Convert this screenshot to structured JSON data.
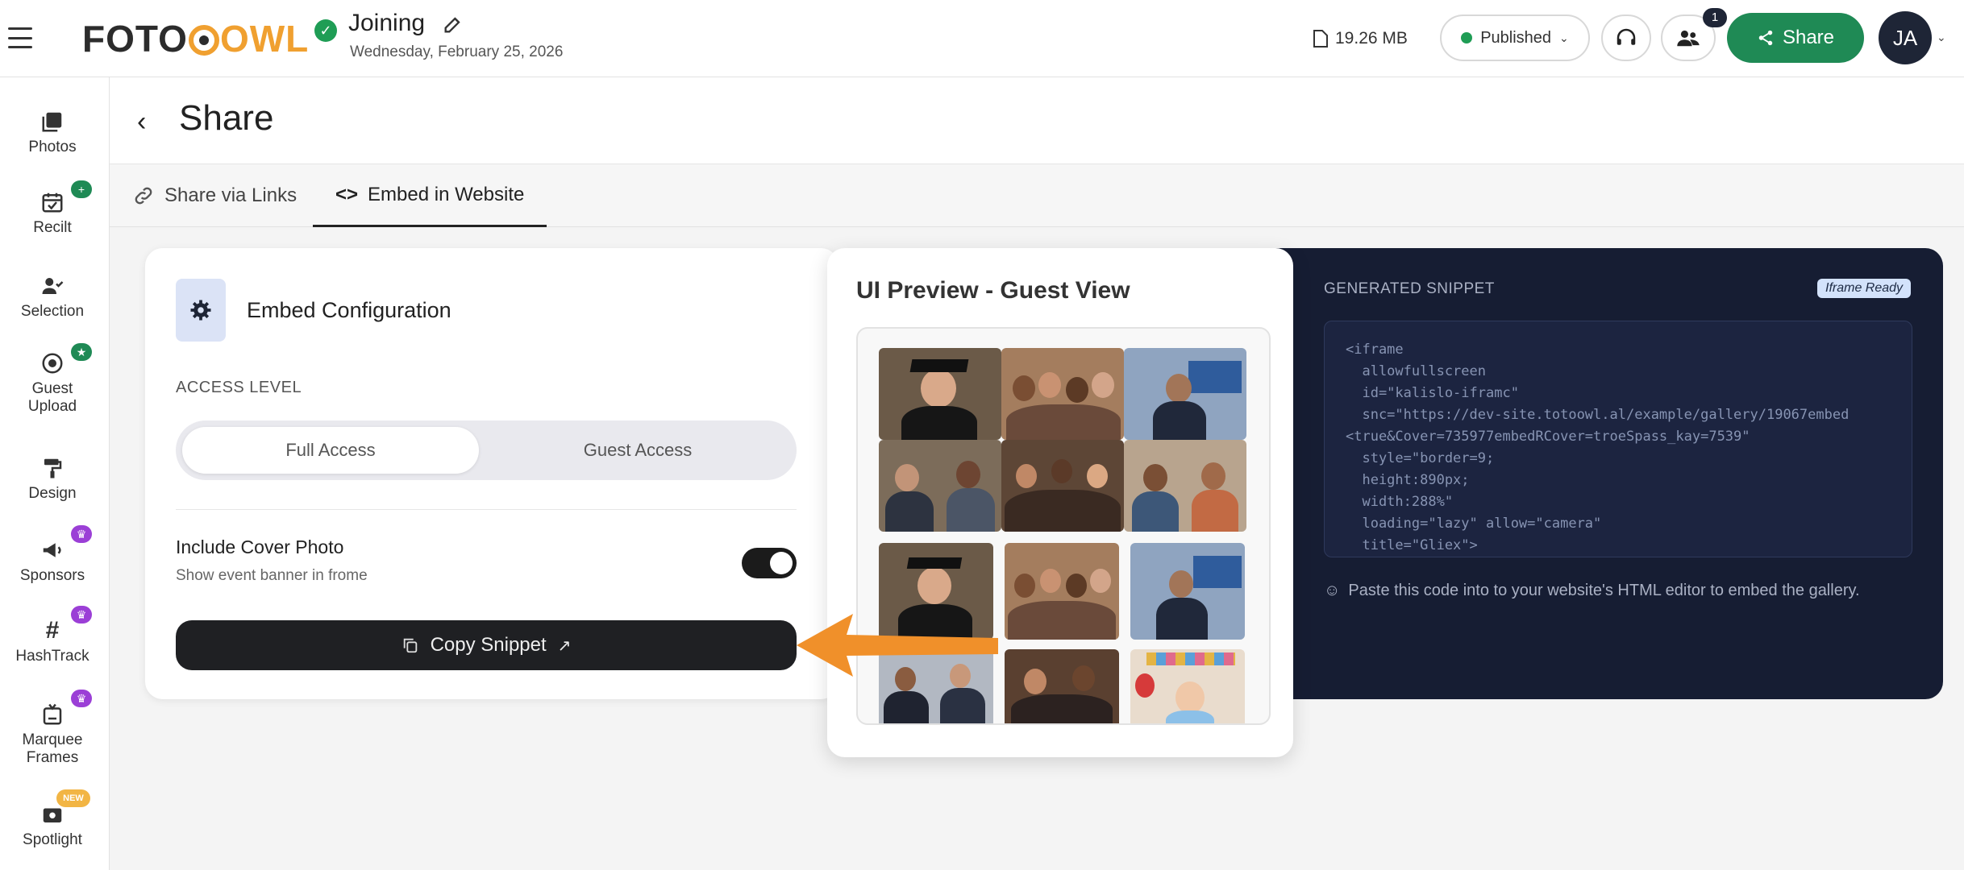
{
  "app": {
    "brand_part1": "FOTO",
    "brand_part2": "OWL"
  },
  "event": {
    "title": "Joining",
    "date": "Wednesday, February 25, 2026"
  },
  "header": {
    "storage": "19.26 MB",
    "status": "Published",
    "notification_count": "1",
    "share_label": "Share",
    "avatar_initials": "JA"
  },
  "sidebar": {
    "items": [
      {
        "label": "Photos"
      },
      {
        "label": "Recilt",
        "badge": "+"
      },
      {
        "label": "Selection"
      },
      {
        "label": "Guest Upload",
        "badge": "★"
      },
      {
        "label": "Design"
      },
      {
        "label": "Sponsors",
        "badge": "♛"
      },
      {
        "label": "HashTrack",
        "badge": "♛"
      },
      {
        "label": "Marquee Frames",
        "badge": "♛"
      },
      {
        "label": "Spotlight",
        "badge": "NEW"
      }
    ]
  },
  "page": {
    "title": "Share",
    "tabs": [
      {
        "label": "Share via Links"
      },
      {
        "label": "Embed in Website"
      }
    ]
  },
  "config": {
    "title": "Embed Configuration",
    "access_label": "ACCESS LEVEL",
    "access_options": [
      "Full Access",
      "Guest Access"
    ],
    "access_selected": "Full Access",
    "cover_title": "Include Cover Photo",
    "cover_sub": "Show event banner in frome",
    "cover_enabled": true,
    "copy_label": "Copy Snippet"
  },
  "preview": {
    "title": "UI Preview - Guest View"
  },
  "snippet": {
    "label": "GENERATED SNIPPET",
    "badge": "Iframe Ready",
    "code": "<iframe\n  allowfullscreen\n  id=\"kalislo-iframc\"\n  snc=\"https://dev-site.totoowl.al/example/gallery/19067embed\n<true&Cover=735977embedRCover=troeSpass_kay=7539\"\n  style=\"border=9;\n  height:890px;\n  width:288%\"\n  loading=\"lazy\" allow=\"camera\"\n  title=\"Gliex\">",
    "hint": "Paste this code into to your website's HTML editor to embed the gallery."
  },
  "colors": {
    "brand_green": "#1f8a55",
    "brand_orange": "#f0a030",
    "dark_navy": "#161d33",
    "badge_purple": "#9b3fd6"
  }
}
